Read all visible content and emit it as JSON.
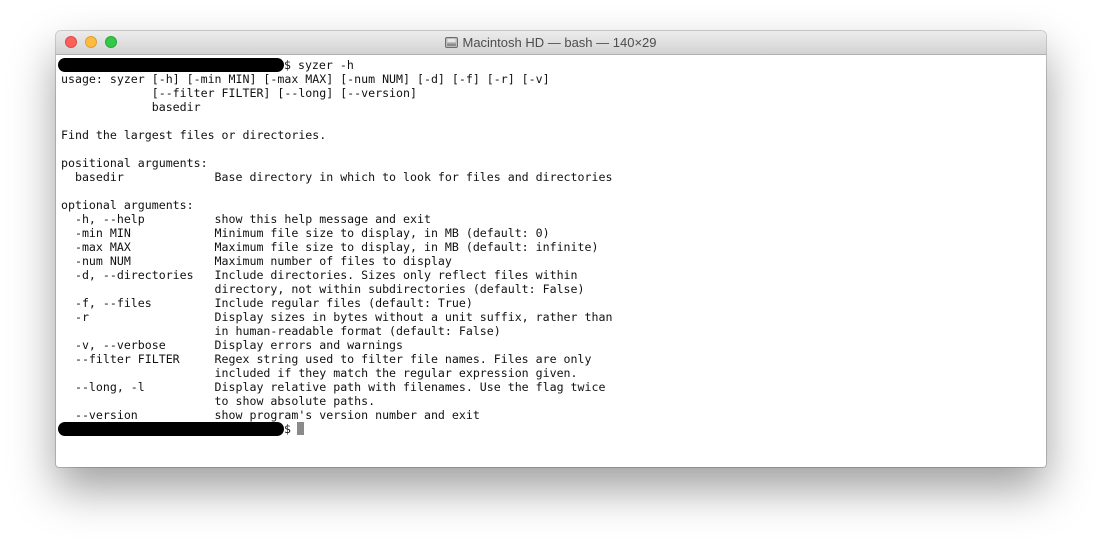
{
  "window": {
    "title": "Macintosh HD — bash — 140×29",
    "title_icon": "disk-icon"
  },
  "terminal": {
    "prompt_symbol": "$",
    "command": " syzer -h",
    "output_lines": [
      "usage: syzer [-h] [-min MIN] [-max MAX] [-num NUM] [-d] [-f] [-r] [-v]",
      "             [--filter FILTER] [--long] [--version]",
      "             basedir",
      "",
      "Find the largest files or directories.",
      "",
      "positional arguments:",
      "  basedir             Base directory in which to look for files and directories",
      "",
      "optional arguments:",
      "  -h, --help          show this help message and exit",
      "  -min MIN            Minimum file size to display, in MB (default: 0)",
      "  -max MAX            Maximum file size to display, in MB (default: infinite)",
      "  -num NUM            Maximum number of files to display",
      "  -d, --directories   Include directories. Sizes only reflect files within",
      "                      directory, not within subdirectories (default: False)",
      "  -f, --files         Include regular files (default: True)",
      "  -r                  Display sizes in bytes without a unit suffix, rather than",
      "                      in human-readable format (default: False)",
      "  -v, --verbose       Display errors and warnings",
      "  --filter FILTER     Regex string used to filter file names. Files are only",
      "                      included if they match the regular expression given.",
      "  --long, -l          Display relative path with filenames. Use the flag twice",
      "                      to show absolute paths.",
      "  --version           show program's version number and exit"
    ]
  }
}
